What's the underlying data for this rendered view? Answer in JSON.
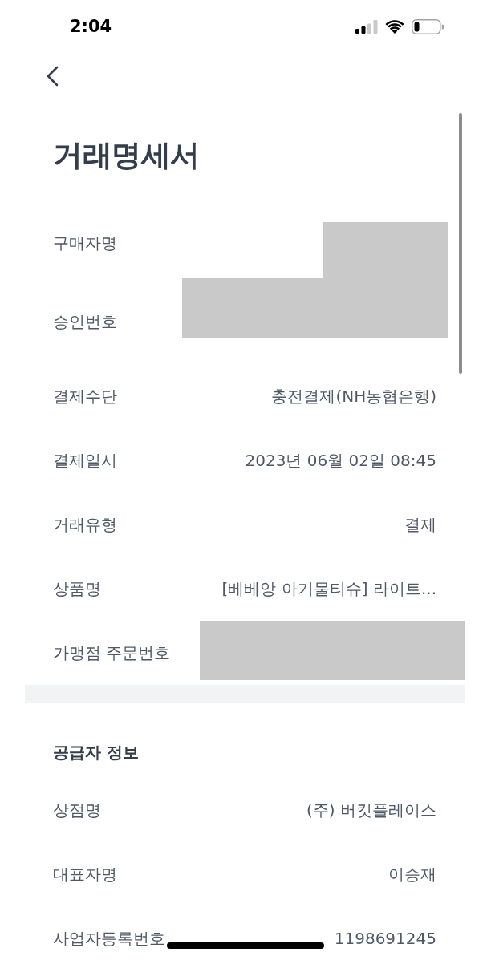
{
  "status_bar": {
    "time": "2:04"
  },
  "title": "거래명세서",
  "details": [
    {
      "label": "구매자명",
      "redacted": true
    },
    {
      "label": "승인번호",
      "redacted": true
    },
    {
      "label": "결제수단",
      "value": "충전결제(NH농협은행)",
      "redacted": false
    },
    {
      "label": "결제일시",
      "value": "2023년 06월 02일 08:45",
      "redacted": false
    },
    {
      "label": "거래유형",
      "value": "결제",
      "redacted": false
    },
    {
      "label": "상품명",
      "value": "[베베앙 아기물티슈] 라이트...",
      "redacted": false
    },
    {
      "label": "가맹점 주문번호",
      "redacted": true
    }
  ],
  "supplier": {
    "heading": "공급자 정보",
    "rows": [
      {
        "label": "상점명",
        "value": "(주) 버킷플레이스"
      },
      {
        "label": "대표자명",
        "value": "이승재"
      },
      {
        "label": "사업자등록번호",
        "value": "1198691245"
      }
    ]
  }
}
